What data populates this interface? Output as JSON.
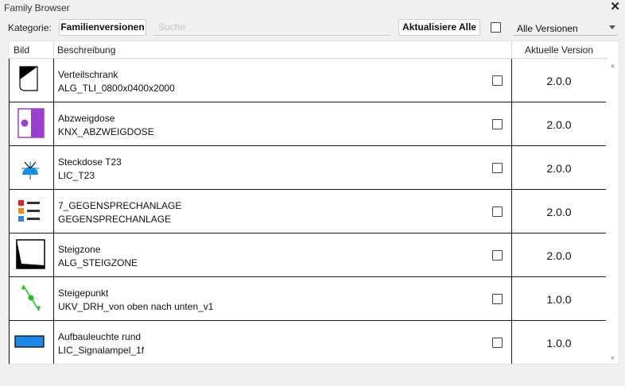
{
  "window": {
    "title": "Family Browser",
    "close_glyph": "✕"
  },
  "toolbar": {
    "kategorie_label": "Kategorie:",
    "familienversionen_label": "Familienversionen",
    "search_placeholder": "Suche",
    "search_value": "",
    "aktualisiere_alle_label": "Aktualisiere Alle",
    "version_filter_selected": "Alle Versionen"
  },
  "table": {
    "columns": [
      "Bild",
      "Beschreibung",
      "Aktuelle Version"
    ],
    "rows": [
      {
        "icon": "cabinet-icon",
        "name": "Verteilschrank",
        "type": "ALG_TLI_0800x0400x2000",
        "checked": false,
        "version": "2.0.0"
      },
      {
        "icon": "junction-box-icon",
        "name": "Abzweigdose",
        "type": "KNX_ABZWEIGDOSE",
        "checked": false,
        "version": "2.0.0"
      },
      {
        "icon": "socket-icon",
        "name": "Steckdose T23",
        "type": "LIC_T23",
        "checked": false,
        "version": "2.0.0"
      },
      {
        "icon": "intercom-list-icon",
        "name": "7_GEGENSPRECHANLAGE",
        "type": "GEGENSPRECHANLAGE",
        "checked": false,
        "version": "2.0.0"
      },
      {
        "icon": "riser-zone-icon",
        "name": "Steigzone",
        "type": "ALG_STEIGZONE",
        "checked": false,
        "version": "2.0.0"
      },
      {
        "icon": "riser-point-icon",
        "name": "Steigepunkt",
        "type": "UKV_DRH_von oben nach unten_v1",
        "checked": false,
        "version": "1.0.0"
      },
      {
        "icon": "ceiling-light-icon",
        "name": "Aufbauleuchte rund",
        "type": "LIC_Signalampel_1f",
        "checked": false,
        "version": "1.0.0"
      }
    ]
  },
  "colors": {
    "junction_purple": "#9b3fcf",
    "socket_blue": "#1a8fe0",
    "riser_green": "#22c022",
    "light_blue": "#1e88e5",
    "intercom_red": "#d8262b",
    "intercom_orange": "#f08c1e",
    "intercom_blue": "#2f84d4"
  }
}
